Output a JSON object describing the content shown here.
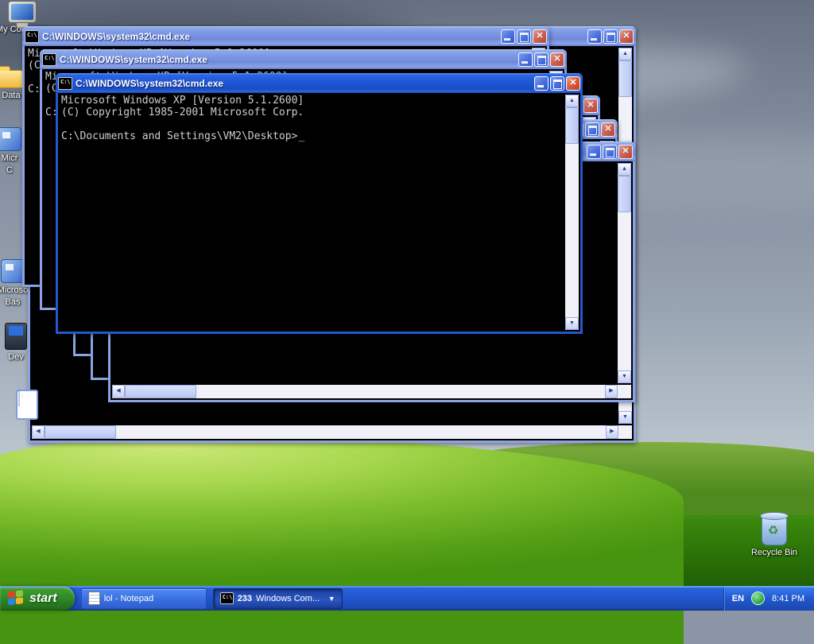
{
  "desktop": {
    "icons": [
      {
        "id": "my-computer",
        "label": "My Computer"
      },
      {
        "id": "data-folder",
        "label": "Data"
      },
      {
        "id": "unknown-app",
        "label": "Micr",
        "label2": "C"
      },
      {
        "id": "microsoft-basics",
        "label": "Microso",
        "label2": "Bas"
      },
      {
        "id": "dev",
        "label": "Dev"
      },
      {
        "id": "recycle-bin",
        "label": "Recycle Bin"
      }
    ]
  },
  "window": {
    "title": "C:\\WINDOWS\\system32\\cmd.exe",
    "console_text": "Microsoft Windows XP [Version 5.1.2600]\n(C) Copyright 1985-2001 Microsoft Corp.\n\nC:\\Documents and Settings\\VM2\\Desktop>",
    "cursor": "_"
  },
  "taskbar": {
    "start_label": "start",
    "tasks": [
      {
        "icon": "notepad-icon",
        "label": "lol - Notepad"
      },
      {
        "icon": "cmd-icon",
        "count": "233",
        "label": "Windows Com...",
        "grouped": true
      }
    ],
    "tray": {
      "language": "EN",
      "time": "8:41 PM"
    }
  },
  "colors": {
    "taskbar_blue": "#2257cf",
    "start_green": "#2f8a25",
    "title_active": "#1f57d6",
    "title_inactive": "#7b97e4",
    "console_bg": "#000000",
    "console_fg": "#cfcfcf"
  }
}
